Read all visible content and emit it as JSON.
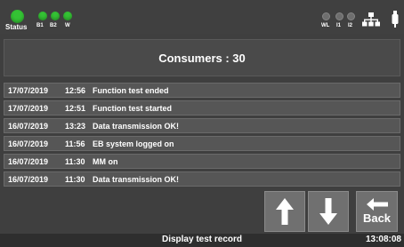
{
  "status_bar": {
    "status_label": "Status",
    "b1_label": "B1",
    "b2_label": "B2",
    "w_label": "W",
    "wl_label": "WL",
    "i1_label": "I1",
    "i2_label": "I2",
    "led_on_color": "#34c234",
    "led_off_color": "#6e6e6e",
    "network_icon": "network-icon",
    "usb_icon": "usb-icon"
  },
  "header": {
    "consumers_text": "Consumers : 30"
  },
  "log": [
    {
      "date": "17/07/2019",
      "time": "12:56",
      "message": "Function test ended"
    },
    {
      "date": "17/07/2019",
      "time": "12:51",
      "message": "Function test started"
    },
    {
      "date": "16/07/2019",
      "time": "13:23",
      "message": "Data transmission OK!"
    },
    {
      "date": "16/07/2019",
      "time": "11:56",
      "message": "EB system logged on"
    },
    {
      "date": "16/07/2019",
      "time": "11:30",
      "message": "MM on"
    },
    {
      "date": "16/07/2019",
      "time": "11:30",
      "message": "Data transmission OK!"
    }
  ],
  "buttons": {
    "up_icon": "arrow-up-icon",
    "down_icon": "arrow-down-icon",
    "back_label": "Back",
    "back_icon": "arrow-left-icon"
  },
  "footer": {
    "title": "Display  test record",
    "clock": "13:08:08"
  }
}
